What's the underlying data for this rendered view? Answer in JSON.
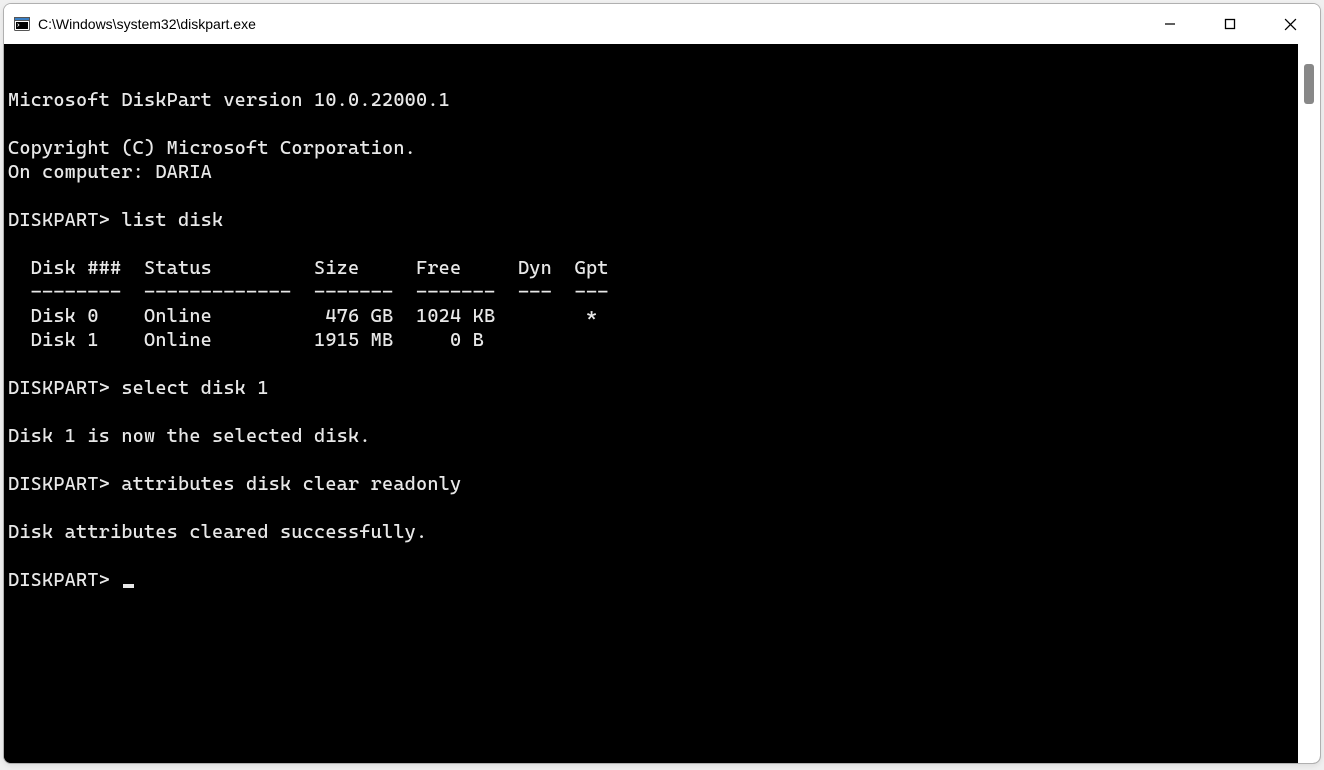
{
  "window": {
    "title": "C:\\Windows\\system32\\diskpart.exe"
  },
  "terminal": {
    "lines": [
      "",
      "Microsoft DiskPart version 10.0.22000.1",
      "",
      "Copyright (C) Microsoft Corporation.",
      "On computer: DARIA",
      "",
      "DISKPART> list disk",
      "",
      "  Disk ###  Status         Size     Free     Dyn  Gpt",
      "  --------  -------------  -------  -------  ---  ---",
      "  Disk 0    Online          476 GB  1024 KB        *",
      "  Disk 1    Online         1915 MB     0 B",
      "",
      "DISKPART> select disk 1",
      "",
      "Disk 1 is now the selected disk.",
      "",
      "DISKPART> attributes disk clear readonly",
      "",
      "Disk attributes cleared successfully.",
      "",
      "DISKPART> "
    ]
  },
  "disks": [
    {
      "id": "Disk 0",
      "status": "Online",
      "size": "476 GB",
      "free": "1024 KB",
      "dyn": "",
      "gpt": "*"
    },
    {
      "id": "Disk 1",
      "status": "Online",
      "size": "1915 MB",
      "free": "0 B",
      "dyn": "",
      "gpt": ""
    }
  ]
}
